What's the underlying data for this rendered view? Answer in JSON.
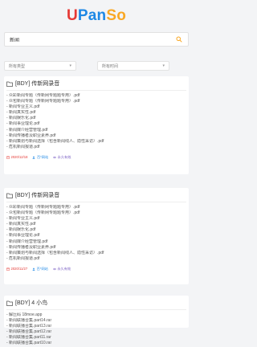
{
  "logo": {
    "part1": "U",
    "part2": "Pan",
    "part3": "So"
  },
  "search": {
    "value": "新闻",
    "placeholder": ""
  },
  "filters": {
    "type_label": "所有类型",
    "time_label": "所有时间"
  },
  "colors": {
    "accent_red": "#e53935",
    "accent_blue": "#1e88e5",
    "accent_yellow": "#f9a825",
    "accent_purple": "#7b61c4"
  },
  "results": [
    {
      "title": "[BDY] 传新网录音",
      "files": [
        "- 众彩新闻专题（传新网专题题专用）.pdf",
        "- 众包新闻专题（传新网专题题专用）.pdf",
        "- 新闻专业主义.pdf",
        "- 新闻真实性.pdf",
        "- 新闻娱乐化.pdf",
        "- 新闻事业理论.pdf",
        "- 新闻媒介经营管理.pdf",
        "- 新闻传播者及职业素养.pdf",
        "- 新闻策划与新闻选择（包含新闻线人、隐性采访）.pdf",
        "- 危机新闻报道.pdf"
      ],
      "date": "2020/12/18",
      "source": "百*网站",
      "expire": "永久有效"
    },
    {
      "title": "[BDY] 传新网录音",
      "files": [
        "- 众彩新闻专题（传新网专题题专用）.pdf",
        "- 众包新闻专题（传新网专题题专用）.pdf",
        "- 新闻专业主义.pdf",
        "- 新闻真实性.pdf",
        "- 新闻娱乐化.pdf",
        "- 新闻事业理论.pdf",
        "- 新闻媒介经营管理.pdf",
        "- 新闻传播者及职业素养.pdf",
        "- 新闻策划与新闻选择（包含新闻线人、隐性采访）.pdf",
        "- 危机新闻报道.pdf"
      ],
      "date": "2020/11/27",
      "source": "百*网站",
      "expire": "永久有效"
    },
    {
      "title": "[BDY] 4 小鸟",
      "files": [
        "- 解压码 18moe.app",
        "- 新闻联播合集.part14.rar",
        "- 新闻联播合集.part13.rar",
        "- 新闻联播合集.part12.rar",
        "- 新闻联播合集.part11.rar",
        "- 新闻联播合集.part10.rar"
      ]
    }
  ]
}
